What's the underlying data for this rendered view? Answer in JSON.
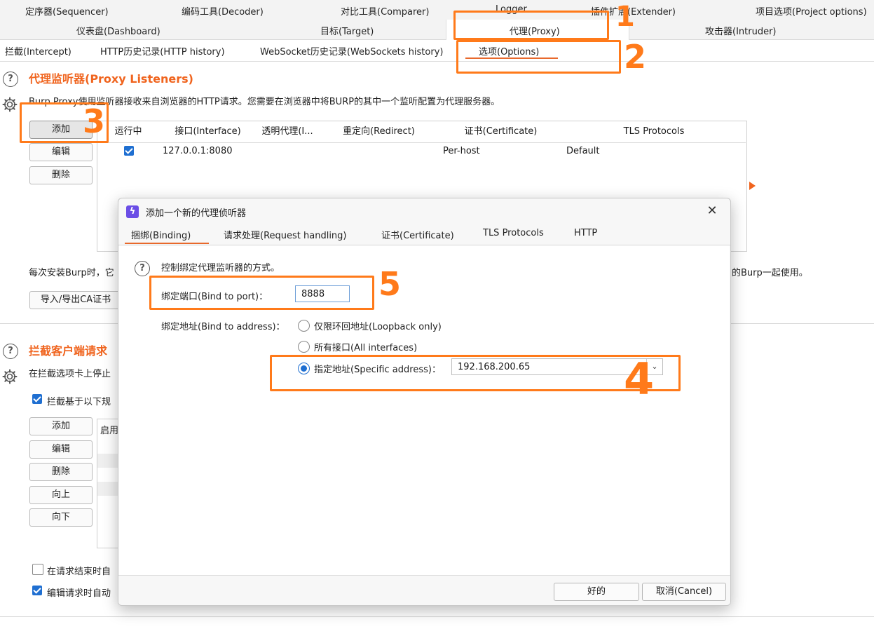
{
  "top_tabs_row1": [
    "定序器(Sequencer)",
    "编码工具(Decoder)",
    "对比工具(Comparer)",
    "Logger",
    "插件扩展(Extender)",
    "项目选项(Project options)"
  ],
  "top_tabs_row2": [
    "仪表盘(Dashboard)",
    "目标(Target)",
    "代理(Proxy)",
    "攻击器(Intruder)"
  ],
  "proxy_subtabs": [
    "拦截(Intercept)",
    "HTTP历史记录(HTTP history)",
    "WebSocket历史记录(WebSockets history)",
    "选项(Options)"
  ],
  "listeners": {
    "title": "代理监听器(Proxy Listeners)",
    "description": "Burp Proxy使用监听器接收来自浏览器的HTTP请求。您需要在浏览器中将BURP的其中一个监听配置为代理服务器。",
    "buttons": {
      "add": "添加",
      "edit": "编辑",
      "remove": "删除"
    },
    "columns": [
      "运行中",
      "接口(Interface)",
      "透明代理(I...",
      "重定向(Redirect)",
      "证书(Certificate)",
      "TLS Protocols"
    ],
    "rows": [
      {
        "running": true,
        "interface": "127.0.0.1:8080",
        "invisible": "",
        "redirect": "",
        "certificate": "Per-host",
        "tls": "Default"
      }
    ],
    "ca_text_left": "每次安装Burp时，它",
    "ca_text_right": "的Burp一起使用。",
    "ca_button": "导入/导出CA证书"
  },
  "intercept": {
    "title": "拦截客户端请求",
    "description": "在拦截选项卡上停止",
    "checkbox_label": "拦截基于以下规",
    "buttons": {
      "add": "添加",
      "edit": "编辑",
      "remove": "删除",
      "up": "向上",
      "down": "向下"
    },
    "column_enabled": "启用",
    "opt1_label": "在请求结束时自",
    "opt2_label": "编辑请求时自动"
  },
  "dialog": {
    "title": "添加一个新的代理侦听器",
    "close_glyph": "✕",
    "icon_glyph": "ϟ",
    "tabs": [
      "捆绑(Binding)",
      "请求处理(Request handling)",
      "证书(Certificate)",
      "TLS Protocols",
      "HTTP"
    ],
    "help_text": "控制绑定代理监听器的方式。",
    "bind_port_label": "绑定端口(Bind to port)：",
    "bind_port_value": "8888",
    "bind_address_label": "绑定地址(Bind to address)：",
    "options": {
      "loopback": "仅限环回地址(Loopback only)",
      "all": "所有接口(All interfaces)",
      "specific": "指定地址(Specific address)："
    },
    "selected_option": "specific",
    "specific_address_value": "192.168.200.65",
    "ok": "好的",
    "cancel": "取消(Cancel)"
  },
  "annotations": [
    "1",
    "2",
    "3",
    "5",
    "4"
  ]
}
